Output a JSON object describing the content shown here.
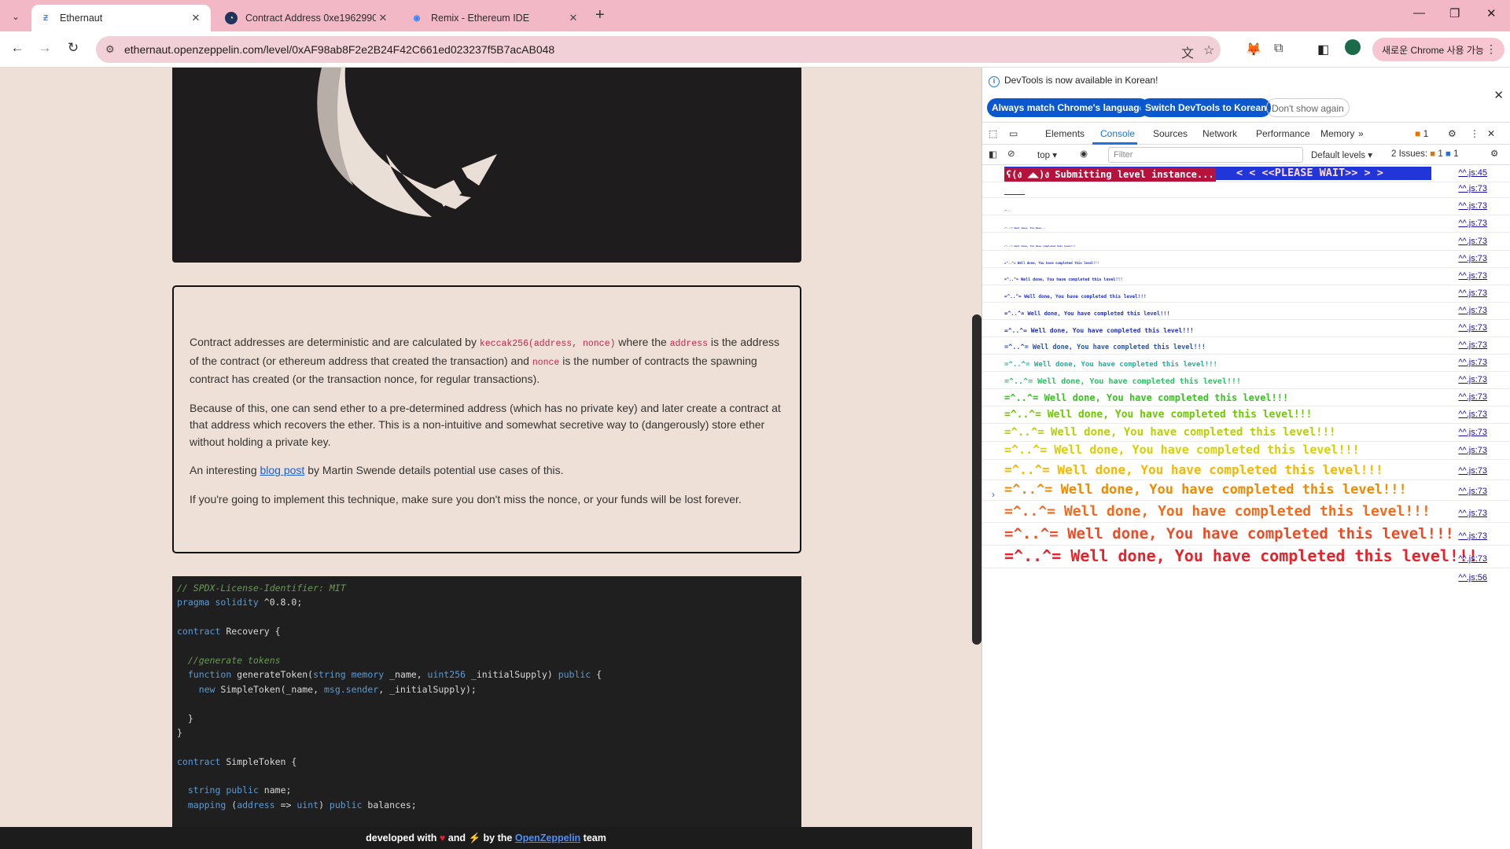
{
  "browser": {
    "tabs": [
      {
        "title": "Ethernaut",
        "active": true
      },
      {
        "title": "Contract Address 0xe1962990",
        "active": false
      },
      {
        "title": "Remix - Ethereum IDE",
        "active": false
      }
    ],
    "url": "ethernaut.openzeppelin.com/level/0xAF98ab8F2e2B24F42C661ed023237f5B7acAB048",
    "chrome_pill": "새로운 Chrome 사용 가능"
  },
  "page": {
    "desc": {
      "p1_a": "Contract addresses are deterministic and are calculated by ",
      "p1_code1": "keccak256(address, nonce)",
      "p1_b": " where the ",
      "p1_code2": "address",
      "p1_c": " is the address of the contract (or ethereum address that created the transaction) and ",
      "p1_code3": "nonce",
      "p1_d": " is the number of contracts the spawning contract has created (or the transaction nonce, for regular transactions).",
      "p2": "Because of this, one can send ether to a pre-determined address (which has no private key) and later create a contract at that address which recovers the ether. This is a non-intuitive and somewhat secretive way to (dangerously) store ether without holding a private key.",
      "p3_a": "An interesting ",
      "p3_link": "blog post",
      "p3_b": " by Martin Swende details potential use cases of this.",
      "p4": "If you're going to implement this technique, make sure you don't miss the nonce, or your funds will be lost forever."
    },
    "code": [
      "// SPDX-License-Identifier: MIT",
      "pragma solidity ^0.8.0;",
      "",
      "contract Recovery {",
      "",
      "  //generate tokens",
      "  function generateToken(string memory _name, uint256 _initialSupply) public {",
      "    new SimpleToken(_name, msg.sender, _initialSupply);",
      "",
      "  }",
      "}",
      "",
      "contract SimpleToken {",
      "",
      "  string public name;",
      "  mapping (address => uint) public balances;"
    ],
    "footer": {
      "a": "developed with ",
      "b": " and ",
      "c": " by the ",
      "link": "OpenZeppelin",
      "d": " team"
    }
  },
  "devtools": {
    "banner_text": "DevTools is now available in Korean!",
    "btn_match": "Always match Chrome's language",
    "btn_switch": "Switch DevTools to Korean",
    "btn_dont": "Don't show again",
    "tabs": [
      "Elements",
      "Console",
      "Sources",
      "Network",
      "Performance",
      "Memory"
    ],
    "warn_count": "1",
    "context": "top",
    "filter_placeholder": "Filter",
    "levels": "Default levels",
    "issues": "2 Issues:",
    "issues_warn": "1",
    "issues_info": "1",
    "submit_left": "ʕ(ง ◢◣)ง Submitting level instance...",
    "submit_right": "<  < <<PLEASE WAIT>> >  >",
    "submit_src": "^^.js:45",
    "well_done": "=^..^= Well done, You have completed this level!!!",
    "row_src": "^^.js:73",
    "last_src": "^^.js:56",
    "colors": {
      "blue": "#1f2fd0",
      "green": "#22c55e",
      "yellow": "#d9cf00",
      "orange": "#f08a00",
      "red": "#e8222a"
    }
  }
}
